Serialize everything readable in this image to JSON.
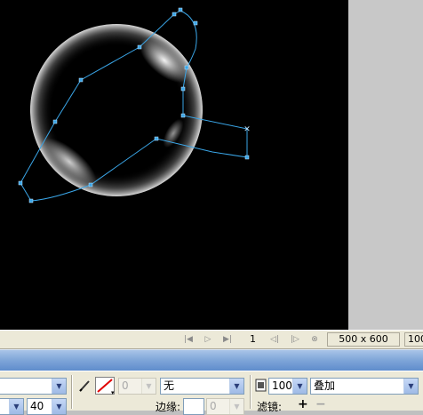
{
  "status_bar": {
    "frame_number": "1",
    "canvas_size": "500 x 600",
    "zoom": "100"
  },
  "properties": {
    "font_size": "40",
    "stroke_size_value": "0",
    "fill_option": "无",
    "edge_label": "边缘:",
    "edge_value": "0",
    "opacity": "100",
    "blend_mode": "叠加",
    "filters_label": "滤镜:",
    "add_filter": "+",
    "remove_filter": "−"
  },
  "colors": {
    "canvas_bg": "#000000",
    "path_stroke": "#3aa6e8",
    "panel_bg": "#ece9d8"
  }
}
